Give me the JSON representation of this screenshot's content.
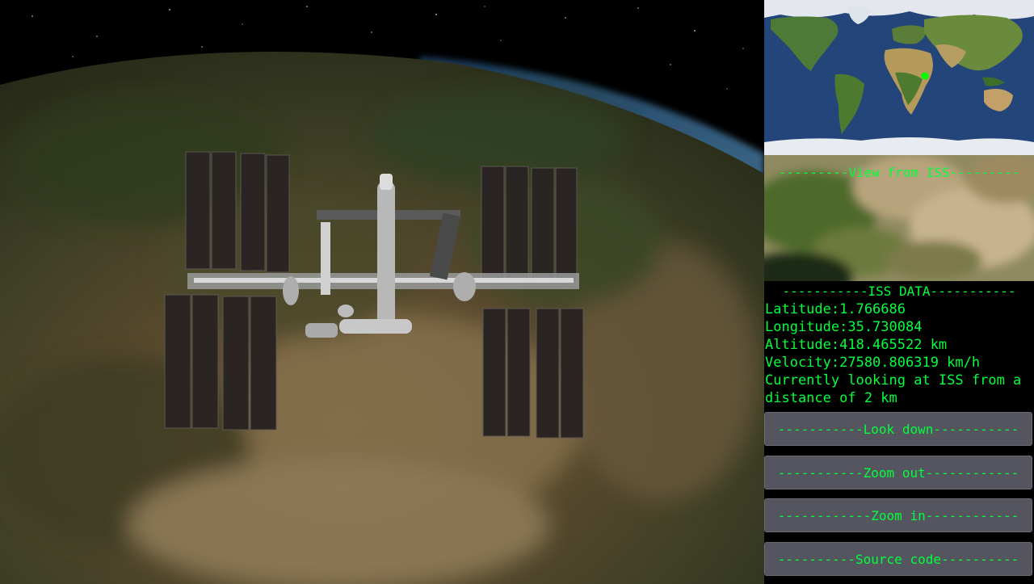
{
  "view_from_iss": {
    "title": "---------View from ISS---------"
  },
  "iss_data": {
    "title": "-----------ISS DATA-----------",
    "latitude": "Latitude:1.766686",
    "longitude": "Longitude:35.730084",
    "altitude": "Altitude:418.465522 km",
    "velocity": "Velocity:27580.806319 km/h",
    "looking": "Currently looking at ISS from a distance of 2 km"
  },
  "buttons": {
    "look_down": "-----------Look down-----------",
    "zoom_out": "-----------Zoom out------------",
    "zoom_in": "------------Zoom in------------",
    "source_code": "----------Source code----------"
  },
  "colors": {
    "text": "#00ff3c",
    "button_bg": "#55555f",
    "iss_marker": "#00ff00"
  }
}
